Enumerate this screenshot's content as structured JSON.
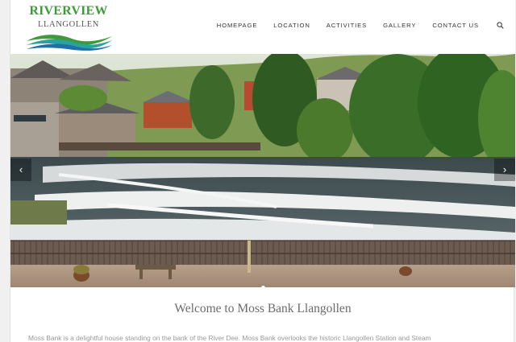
{
  "logo": {
    "title": "RIVERVIEW",
    "subtitle": "LLANGOLLEN"
  },
  "nav": {
    "items": [
      {
        "label": "HOMEPAGE"
      },
      {
        "label": "LOCATION"
      },
      {
        "label": "ACTIVITIES"
      },
      {
        "label": "GALLERY"
      },
      {
        "label": "CONTACT US"
      }
    ],
    "search_icon": "search-icon"
  },
  "slider": {
    "prev_icon": "chevron-left-icon",
    "next_icon": "chevron-right-icon",
    "prev_glyph": "‹",
    "next_glyph": "›",
    "slide_count": 1,
    "active_slide": 1
  },
  "content": {
    "heading": "Welcome to Moss Bank Llangollen",
    "intro": "Moss Bank is a delightful house standing on the bank of the River Dee. Moss Bank overlooks the historic Llangollen Station and Steam"
  },
  "colors": {
    "logo_green": "#3f9a3d",
    "wave_blue": "#1f6fa8",
    "wave_teal": "#2aa3a0"
  }
}
